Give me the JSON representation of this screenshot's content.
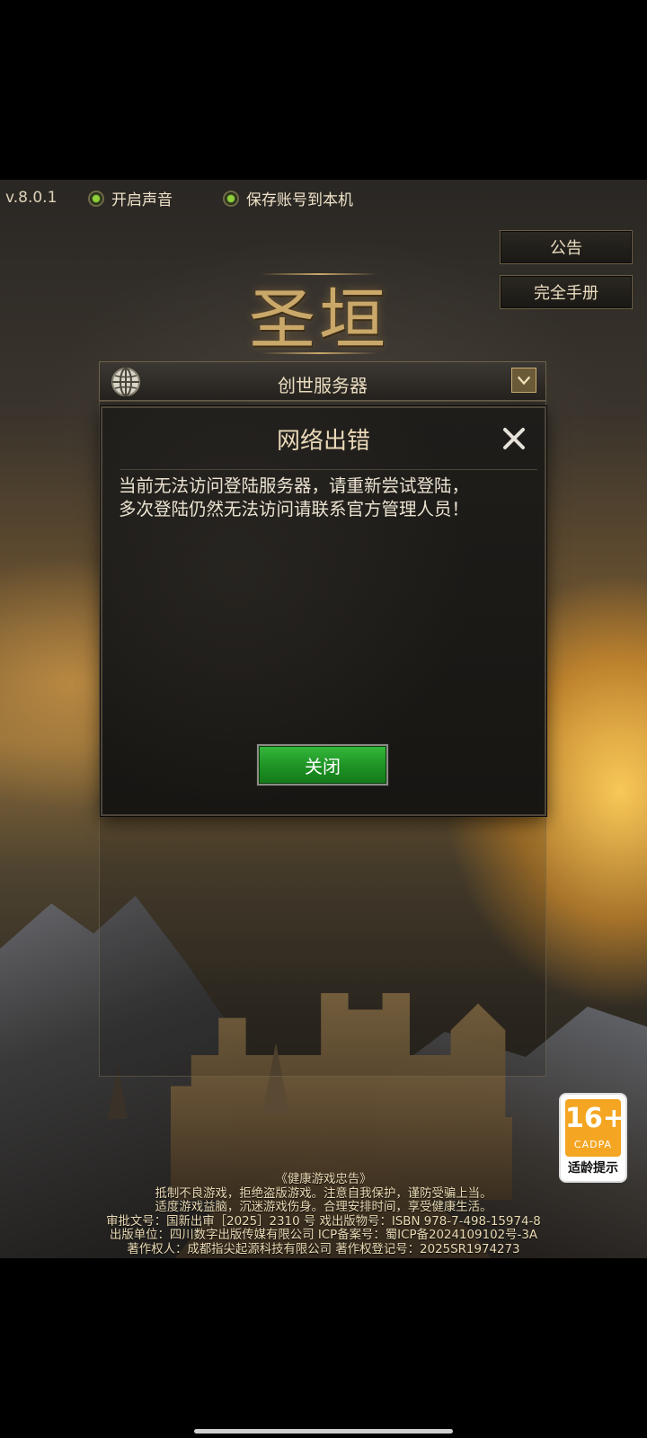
{
  "topbar": {
    "version": "v.8.0.1",
    "sound_toggle_label": "开启声音",
    "save_account_toggle_label": "保存账号到本机"
  },
  "side_buttons": {
    "announcement": "公告",
    "manual": "完全手册"
  },
  "logo": {
    "title": "圣垣"
  },
  "server_selector": {
    "selected_server": "创世服务器"
  },
  "dialog": {
    "title": "网络出错",
    "message_line1": "当前无法访问登陆服务器，请重新尝试登陆，",
    "message_line2": "多次登陆仍然无法访问请联系官方管理人员！",
    "close_button_label": "关闭"
  },
  "age_rating": {
    "age": "16+",
    "org": "CADPA",
    "hint": "适龄提示"
  },
  "footer_notice": {
    "lines": [
      "《健康游戏忠告》",
      "抵制不良游戏，拒绝盗版游戏。注意自我保护，谨防受骗上当。",
      "适度游戏益脑，沉迷游戏伤身。合理安排时间，享受健康生活。",
      "审批文号：国新出审［2025］2310 号  戏出版物号：ISBN 978-7-498-15974-8",
      "出版单位：四川数字出版传媒有限公司  ICP备案号：蜀ICP备2024109102号-3A",
      "著作权人：成都指尖起源科技有限公司   著作权登记号：2025SR1974273"
    ]
  },
  "colors": {
    "accent_green": "#1e9224",
    "toggle_dot": "#8fd03a",
    "gold_text": "#c9a86a",
    "badge_orange": "#f4a623"
  },
  "icons": [
    "globe-icon",
    "chevron-down-icon",
    "close-icon",
    "toggle-radio-icon"
  ]
}
